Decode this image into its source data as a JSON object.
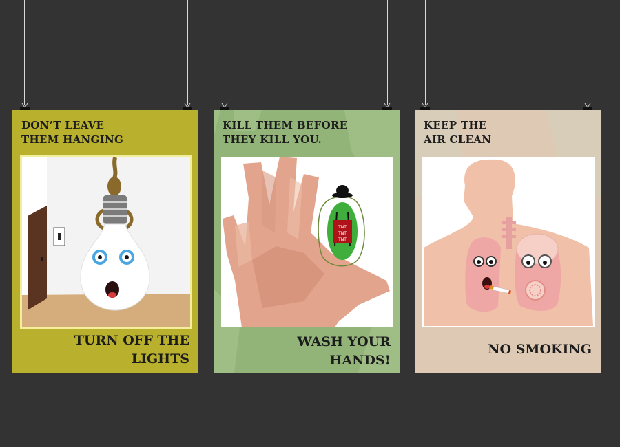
{
  "posters": [
    {
      "title": "DON’T LEAVE\nTHEM HANGING",
      "caption": "TURN OFF THE\nLIGHTS",
      "icons": [
        "noose-icon",
        "lightbulb-icon",
        "light-switch-icon",
        "door-icon"
      ]
    },
    {
      "title": "KILL THEM BEFORE\nTHEY KILL YOU.",
      "caption": "WASH YOUR\nHANDS!",
      "icons": [
        "hand-icon",
        "germ-icon",
        "tnt-icon"
      ],
      "tnt_label": "TNT"
    },
    {
      "title": "KEEP THE\nAIR CLEAN",
      "caption": "NO SMOKING",
      "icons": [
        "silhouette-icon",
        "lungs-icon",
        "cigarette-icon",
        "gas-mask-icon"
      ]
    }
  ],
  "colors": {
    "background": "#333333",
    "poster1": "#b9b12e",
    "poster2": "#9fbe86",
    "poster3": "#d8cdb9"
  }
}
